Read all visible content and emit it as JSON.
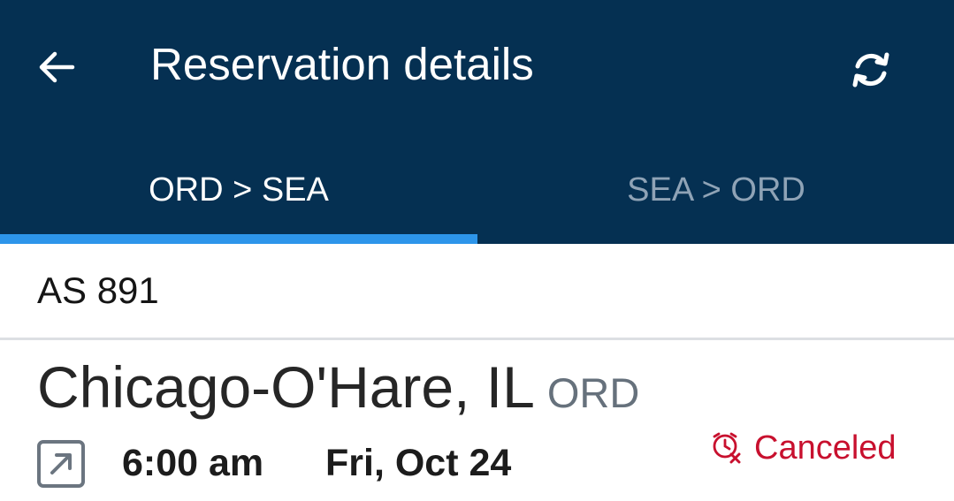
{
  "header": {
    "title": "Reservation details",
    "back_icon": "arrow-left-icon",
    "refresh_icon": "refresh-icon",
    "background": "#053052"
  },
  "tabs": [
    {
      "label": "ORD > SEA",
      "active": true
    },
    {
      "label": "SEA > ORD",
      "active": false
    }
  ],
  "tab_indicator_color": "#2d95ea",
  "flight": {
    "number": "AS 891"
  },
  "departure": {
    "city": "Chicago-O'Hare, IL",
    "code": "ORD",
    "icon": "departure-arrow-icon",
    "time": "6:00 am",
    "date": "Fri, Oct 24",
    "status": "Canceled",
    "status_icon": "clock-cancel-icon",
    "status_color": "#c8102e"
  }
}
